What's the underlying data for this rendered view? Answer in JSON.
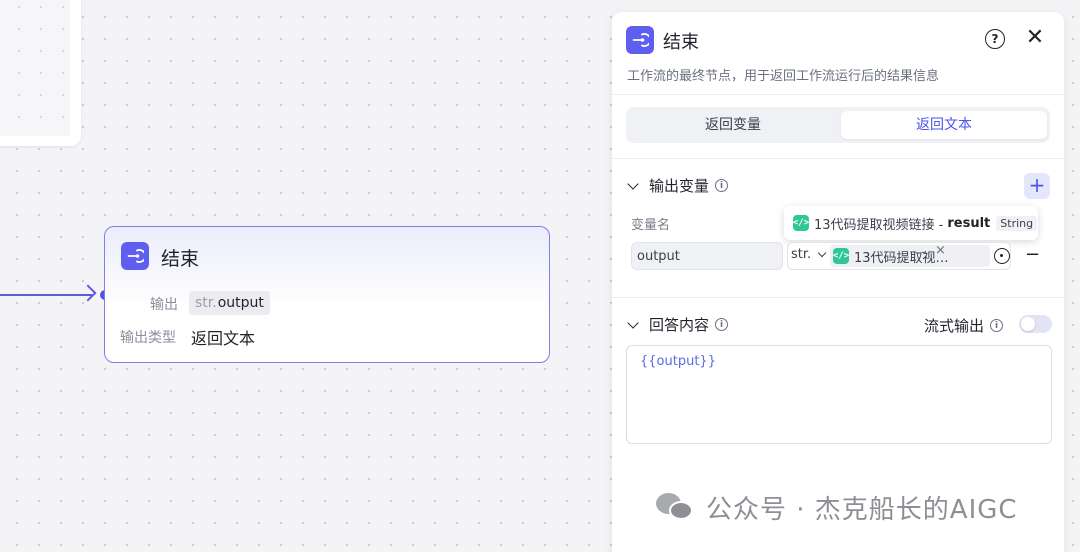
{
  "canvas": {
    "end_node": {
      "title": "结束",
      "output_label": "输出",
      "output_chip_prefix": "str.",
      "output_chip_name": "output",
      "type_label": "输出类型",
      "type_value": "返回文本"
    }
  },
  "panel": {
    "title": "结束",
    "help_icon": "?",
    "close_icon": "✕",
    "description": "工作流的最终节点，用于返回工作流运行后的结果信息",
    "tabs": [
      {
        "label": "返回变量",
        "active": false
      },
      {
        "label": "返回文本",
        "active": true
      }
    ],
    "output_vars": {
      "title": "输出变量",
      "add_icon": "+",
      "col_name": "变量名",
      "tooltip": {
        "source": "13代码提取视频链接 -",
        "field": "result",
        "type": "String"
      },
      "row": {
        "name": "output",
        "type": "str.",
        "ref_text": "13代码提取视…",
        "ref_dash": "-",
        "clear_icon": "×",
        "remove_icon": "−"
      }
    },
    "answer": {
      "title": "回答内容",
      "stream_label": "流式输出",
      "stream_enabled": false,
      "content": "{{output}}"
    }
  },
  "watermark": "公众号 · 杰克船长的AIGC",
  "colors": {
    "accent": "#4d53e8",
    "logo_bg": "#5e5ff0",
    "code_icon": "#2fc79a",
    "node_border": "#7c7ff0"
  }
}
